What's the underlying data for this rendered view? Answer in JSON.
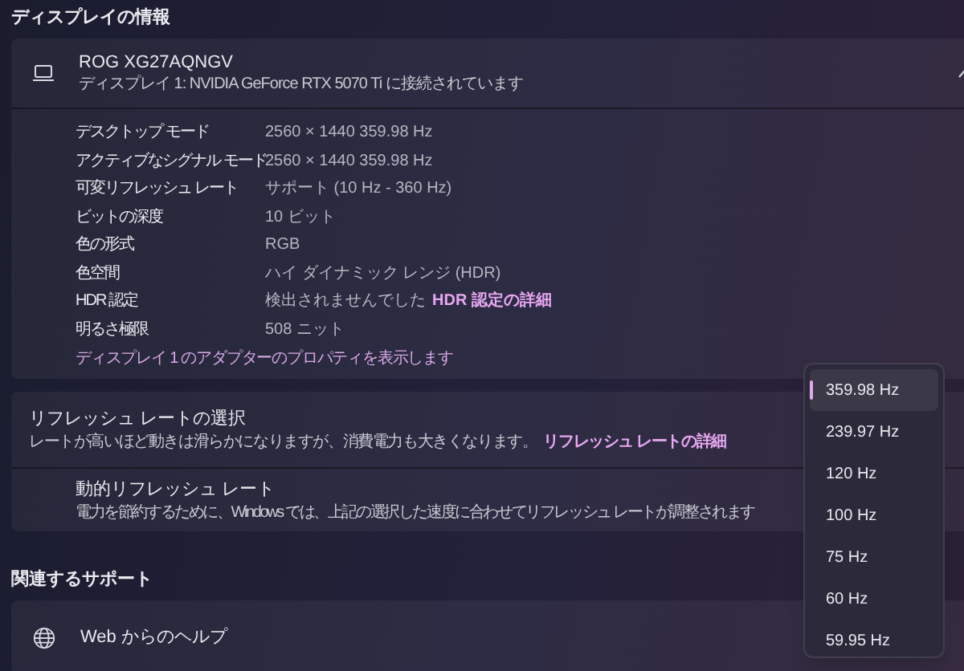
{
  "display_info": {
    "heading": "ディスプレイの情報",
    "monitor": {
      "name": "ROG XG27AQNGV",
      "subtitle": "ディスプレイ 1: NVIDIA GeForce RTX 5070 Ti に接続されています"
    },
    "details": [
      {
        "label": "デスクトップ モード",
        "value": "2560 × 1440 359.98 Hz"
      },
      {
        "label": "アクティブなシグナル モード",
        "value": "2560 × 1440 359.98 Hz"
      },
      {
        "label": "可変リフレッシュ レート",
        "value": "サポート (10 Hz - 360 Hz)"
      },
      {
        "label": "ビットの深度",
        "value": "10 ビット"
      },
      {
        "label": "色の形式",
        "value": "RGB"
      },
      {
        "label": "色空間",
        "value": "ハイ ダイナミック レンジ (HDR)"
      },
      {
        "label": "HDR 認定",
        "value": "検出されませんでした",
        "link": "HDR 認定の詳細"
      },
      {
        "label": "明るさ極限",
        "value": "508 ニット"
      }
    ],
    "adapter_link": "ディスプレイ 1 のアダプターのプロパティを表示します"
  },
  "refresh_rate": {
    "title": "リフレッシュ レートの選択",
    "description": "レートが高いほど動きは滑らかになりますが、消費電力も大きくなります。",
    "link": "リフレッシュ レートの詳細",
    "dynamic": {
      "title": "動的リフレッシュ レート",
      "description": "電力を節約するために、Windows では、上記の選択した速度に合わせてリフレッシュ レートが調整されます"
    }
  },
  "related_support": {
    "heading": "関連するサポート",
    "items": [
      {
        "label": "Web からのヘルプ"
      }
    ]
  },
  "dropdown": {
    "options": [
      {
        "label": "359.98 Hz",
        "selected": true
      },
      {
        "label": "239.97 Hz",
        "selected": false
      },
      {
        "label": "120 Hz",
        "selected": false
      },
      {
        "label": "100 Hz",
        "selected": false
      },
      {
        "label": "75 Hz",
        "selected": false
      },
      {
        "label": "60 Hz",
        "selected": false
      },
      {
        "label": "59.95 Hz",
        "selected": false
      }
    ]
  }
}
